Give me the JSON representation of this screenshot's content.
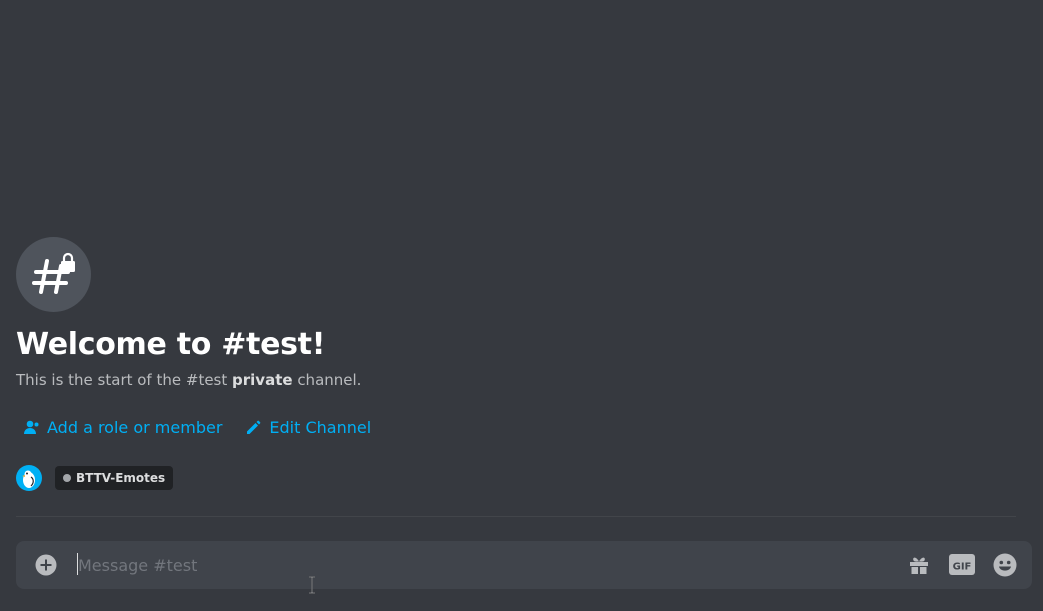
{
  "channel": {
    "name": "test",
    "welcome_title": "Welcome to #test!",
    "desc_prefix": "This is the start of the #test ",
    "desc_bold": "private",
    "desc_suffix": " channel.",
    "icon": "hashtag-lock-icon"
  },
  "actions": {
    "add_role": {
      "label": "Add a role or member",
      "icon": "add-member-icon"
    },
    "edit_channel": {
      "label": "Edit Channel",
      "icon": "pencil-icon"
    }
  },
  "integration": {
    "bot_avatar": "bot-avatar",
    "pill_label": "BTTV-Emotes"
  },
  "composer": {
    "placeholder": "Message #test",
    "value": "",
    "buttons": {
      "upload": "plus-circle-icon",
      "gift": "gift-icon",
      "gif": "gif-icon",
      "emoji": "emoji-icon"
    }
  },
  "colors": {
    "background": "#36393f",
    "link": "#00aff4",
    "composer": "#40444b",
    "avatar_bg": "#4f545c"
  }
}
